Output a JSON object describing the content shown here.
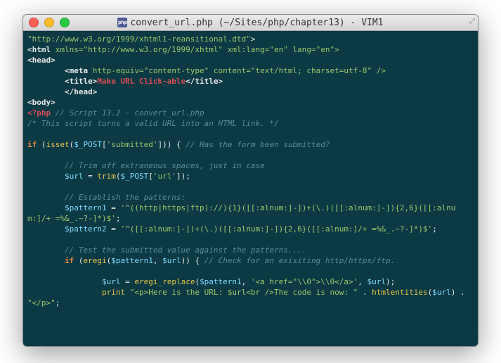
{
  "window": {
    "icon_label": "php",
    "title": "convert_url.php (~/Sites/php/chapter13) - VIM1"
  },
  "code": {
    "l1_doctype": "\"http://www.w3.org/1999/xhtml1-reansitional.dtd\"",
    "l1_close": ">",
    "l2_tag": "<html",
    "l2_attr": " xmlns=\"http://www.w3.org/1999/xhtml\" xml:lang=\"en\" lang=\"en\">",
    "l3": "<head>",
    "l4_indent": "        ",
    "l4_tag": "<meta",
    "l4_attr": " http-equiv=\"content-type\" content=\"text/html; charset=utf-8\" />",
    "l5_indent": "        ",
    "l5_open": "<title>",
    "l5_text": "Make URL Click-able",
    "l5_close": "</title>",
    "l6_indent": "        ",
    "l6": "</head>",
    "l7": "<body>",
    "l8_php": "<?php",
    "l8_cmt": " // Script 13.2 - convert_url.php",
    "l9": "/* This script turns a valid URL into an HTML link. */",
    "l10_if": "if",
    "l10_sp": " (",
    "l10_fn": "isset",
    "l10_p1": "(",
    "l10_var": "$_POST",
    "l10_br1": "[",
    "l10_str": "'submitted'",
    "l10_br2": "]",
    "l10_p2": ")) {",
    "l10_cmt": " // Has the form been submitted?",
    "l11_indent": "        ",
    "l11": "// Trim off extraneous spaces, just in case",
    "l12_indent": "        ",
    "l12_var": "$url",
    "l12_eq": " = ",
    "l12_fn": "trim",
    "l12_p1": "(",
    "l12_var2": "$_POST",
    "l12_br1": "[",
    "l12_str": "'url'",
    "l12_br2": "]",
    "l12_p2": ");",
    "l13_indent": "        ",
    "l13": "// Establish the patterns:",
    "l14_indent": "        ",
    "l14_var": "$pattern1",
    "l14_eq": " = ",
    "l14_str": "'^((http|https|ftp)://){1}([[:alnum:]-])+(\\.)([[:alnum:]-]){2,6}([[:alnum:]/+ =%&_.~?-]*)$'",
    "l14_semi": ";",
    "l15_indent": "        ",
    "l15_var": "$pattern2",
    "l15_eq": " = ",
    "l15_str": "'^([[:alnum:]-])+(\\.)([[:alnum:]-]){2,6}([[:alnum:]/+ =%&_.~?-]*)$'",
    "l15_semi": ";",
    "l16_indent": "        ",
    "l16": "// Test the submitted value against the patterns....",
    "l17_indent": "        ",
    "l17_if": "if",
    "l17_sp": " (",
    "l17_fn": "eregi",
    "l17_p1": "(",
    "l17_var1": "$pattern1",
    "l17_comma": ", ",
    "l17_var2": "$url",
    "l17_p2": ")) {",
    "l17_cmt": " // Check for an exisiting http/https/ftp.",
    "l18_indent": "                ",
    "l18_var": "$url",
    "l18_eq": " = ",
    "l18_fn": "eregi_replace",
    "l18_p1": "(",
    "l18_var2": "$pattern1",
    "l18_comma": ", ",
    "l18_str": "'<a href=\"\\\\0\">\\\\0</a>'",
    "l18_comma2": ", ",
    "l18_var3": "$url",
    "l18_p2": ");",
    "l19_indent": "                ",
    "l19_fn": "print",
    "l19_sp": " ",
    "l19_str1": "\"<p>Here is the URL: $url<br />The code is now: \"",
    "l19_dot": " . ",
    "l19_fn2": "htmlentities",
    "l19_p1": "(",
    "l19_var": "$url",
    "l19_p2": ") . ",
    "l19_str2": "\"</p>\"",
    "l19_semi": ";"
  }
}
